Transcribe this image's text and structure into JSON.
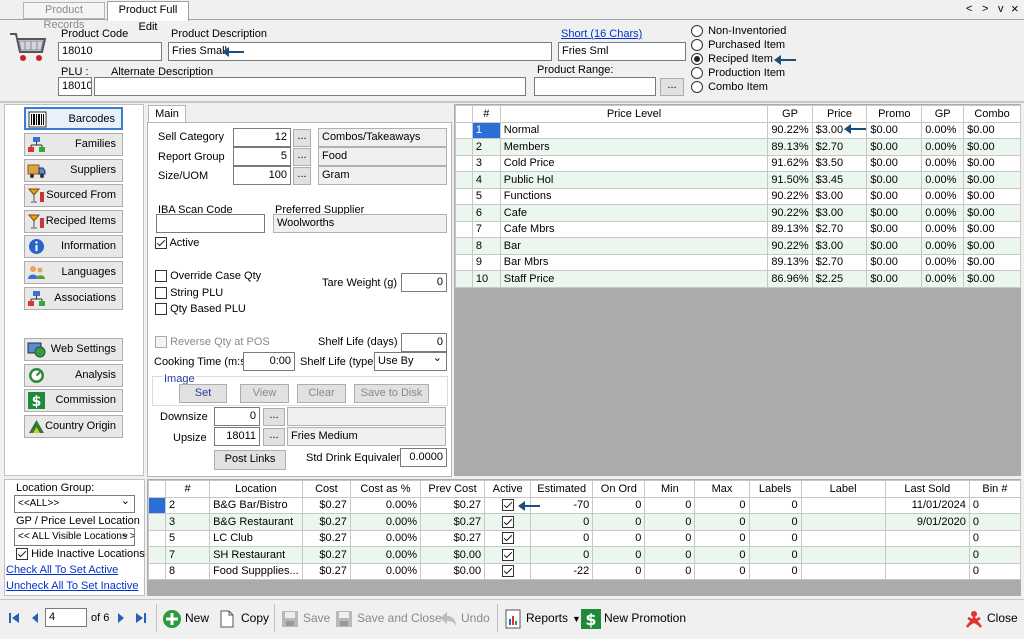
{
  "tabs": [
    "Product Records",
    "Product Full Edit"
  ],
  "window_controls": {
    "left": "<",
    "right": ">",
    "down": "v",
    "close": "×"
  },
  "header": {
    "product_code_label": "Product Code",
    "product_code": "18010",
    "description_label": "Product Description",
    "description": "Fries Small",
    "short_label": "Short (16 Chars)",
    "short": "Fries Sml",
    "plu_label": "PLU :",
    "plu": "18010",
    "alt_desc_label": "Alternate Description",
    "alt_desc": "",
    "range_label": "Product Range:",
    "range": "",
    "ellipsis": "...",
    "types": [
      "Non-Inventoried",
      "Purchased Item",
      "Reciped Item",
      "Production Item",
      "Combo Item"
    ],
    "selected_type": 2
  },
  "nav": {
    "items": [
      {
        "label": "Barcodes",
        "icon": "barcode-icon"
      },
      {
        "label": "Families",
        "icon": "hierarchy-icon"
      },
      {
        "label": "Suppliers",
        "icon": "truck-icon"
      },
      {
        "label": "Sourced From",
        "icon": "cocktail-icon"
      },
      {
        "label": "Reciped Items",
        "icon": "cocktail-icon"
      },
      {
        "label": "Information",
        "icon": "info-icon"
      },
      {
        "label": "Languages",
        "icon": "people-icon"
      },
      {
        "label": "Associations",
        "icon": "hierarchy-icon"
      },
      {
        "label": "Web Settings",
        "icon": "web-icon"
      },
      {
        "label": "Analysis",
        "icon": "gauge-icon"
      },
      {
        "label": "Commission",
        "icon": "dollar-icon"
      },
      {
        "label": "Country Origin",
        "icon": "map-icon"
      }
    ]
  },
  "main": {
    "tab": "Main",
    "sell_category_label": "Sell Category",
    "sell_category_num": "12",
    "sell_category": "Combos/Takeaways",
    "report_group_label": "Report Group",
    "report_group_num": "5",
    "report_group": "Food",
    "size_uom_label": "Size/UOM",
    "size_num": "100",
    "uom": "Gram",
    "iba_label": "IBA Scan Code",
    "iba": "",
    "pref_supplier_label": "Preferred Supplier",
    "pref_supplier": "Woolworths",
    "active_label": "Active",
    "override_case_label": "Override Case Qty",
    "string_plu_label": "String PLU",
    "qty_based_label": "Qty Based PLU",
    "tare_label": "Tare Weight (g) :",
    "tare": "0",
    "reverse_qty_label": "Reverse Qty at POS",
    "shelf_days_label": "Shelf Life (days) :",
    "shelf_days": "0",
    "cooking_label": "Cooking Time (m:s):",
    "cooking": "0:00",
    "shelf_type_label": "Shelf Life (type) :",
    "shelf_type": "Use By",
    "image_label": "Image",
    "image_buttons": [
      "Set",
      "View",
      "Clear",
      "Save to Disk"
    ],
    "downsize_label": "Downsize",
    "downsize_num": "0",
    "downsize": "",
    "upsize_label": "Upsize",
    "upsize_num": "18011",
    "upsize": "Fries Medium",
    "post_links": "Post Links",
    "std_drink_label": "Std Drink Equivalent:",
    "std_drink": "0.0000"
  },
  "price_table": {
    "headers": [
      "#",
      "Price Level",
      "GP",
      "Price",
      "Promo",
      "GP",
      "Combo"
    ],
    "rows": [
      [
        "1",
        "Normal",
        "90.22%",
        "$3.00",
        "$0.00",
        "0.00%",
        "$0.00"
      ],
      [
        "2",
        "Members",
        "89.13%",
        "$2.70",
        "$0.00",
        "0.00%",
        "$0.00"
      ],
      [
        "3",
        "Cold Price",
        "91.62%",
        "$3.50",
        "$0.00",
        "0.00%",
        "$0.00"
      ],
      [
        "4",
        "Public Hol",
        "91.50%",
        "$3.45",
        "$0.00",
        "0.00%",
        "$0.00"
      ],
      [
        "5",
        "Functions",
        "90.22%",
        "$3.00",
        "$0.00",
        "0.00%",
        "$0.00"
      ],
      [
        "6",
        "Cafe",
        "90.22%",
        "$3.00",
        "$0.00",
        "0.00%",
        "$0.00"
      ],
      [
        "7",
        "Cafe Mbrs",
        "89.13%",
        "$2.70",
        "$0.00",
        "0.00%",
        "$0.00"
      ],
      [
        "8",
        "Bar",
        "90.22%",
        "$3.00",
        "$0.00",
        "0.00%",
        "$0.00"
      ],
      [
        "9",
        "Bar Mbrs",
        "89.13%",
        "$2.70",
        "$0.00",
        "0.00%",
        "$0.00"
      ],
      [
        "10",
        "Staff Price",
        "86.96%",
        "$2.25",
        "$0.00",
        "0.00%",
        "$0.00"
      ]
    ]
  },
  "location_panel": {
    "group_label": "Location Group:",
    "group_value": "<<ALL>>",
    "gp_label": "GP / Price Level Location",
    "gp_value": "<< ALL Visible Locations >",
    "hide_inactive_label": "Hide Inactive Locations",
    "check_all": "Check All To Set Active",
    "uncheck_all": "Uncheck All To Set Inactive"
  },
  "location_table": {
    "headers": [
      "#",
      "Location",
      "Cost",
      "Cost as %",
      "Prev Cost",
      "Active",
      "Estimated",
      "On Ord",
      "Min",
      "Max",
      "Labels",
      "Label",
      "Last Sold",
      "Bin #"
    ],
    "rows": [
      [
        "2",
        "B&G Bar/Bistro",
        "$0.27",
        "0.00%",
        "$0.27",
        "-70",
        "0",
        "0",
        "0",
        "0",
        "",
        "11/01/2024",
        "0"
      ],
      [
        "3",
        "B&G Restaurant",
        "$0.27",
        "0.00%",
        "$0.27",
        "0",
        "0",
        "0",
        "0",
        "0",
        "",
        "9/01/2020",
        "0"
      ],
      [
        "5",
        "LC Club",
        "$0.27",
        "0.00%",
        "$0.27",
        "0",
        "0",
        "0",
        "0",
        "0",
        "",
        "",
        "0"
      ],
      [
        "7",
        "SH Restaurant",
        "$0.27",
        "0.00%",
        "$0.00",
        "0",
        "0",
        "0",
        "0",
        "0",
        "",
        "",
        "0"
      ],
      [
        "8",
        "Food Suppplies...",
        "$0.27",
        "0.00%",
        "$0.00",
        "-22",
        "0",
        "0",
        "0",
        "0",
        "",
        "",
        "0"
      ]
    ]
  },
  "bottom": {
    "record": "4",
    "of": "of 6",
    "new": "New",
    "copy": "Copy",
    "save": "Save",
    "save_close": "Save and Close",
    "undo": "Undo",
    "reports": "Reports",
    "new_promo": "New Promotion",
    "close": "Close"
  }
}
